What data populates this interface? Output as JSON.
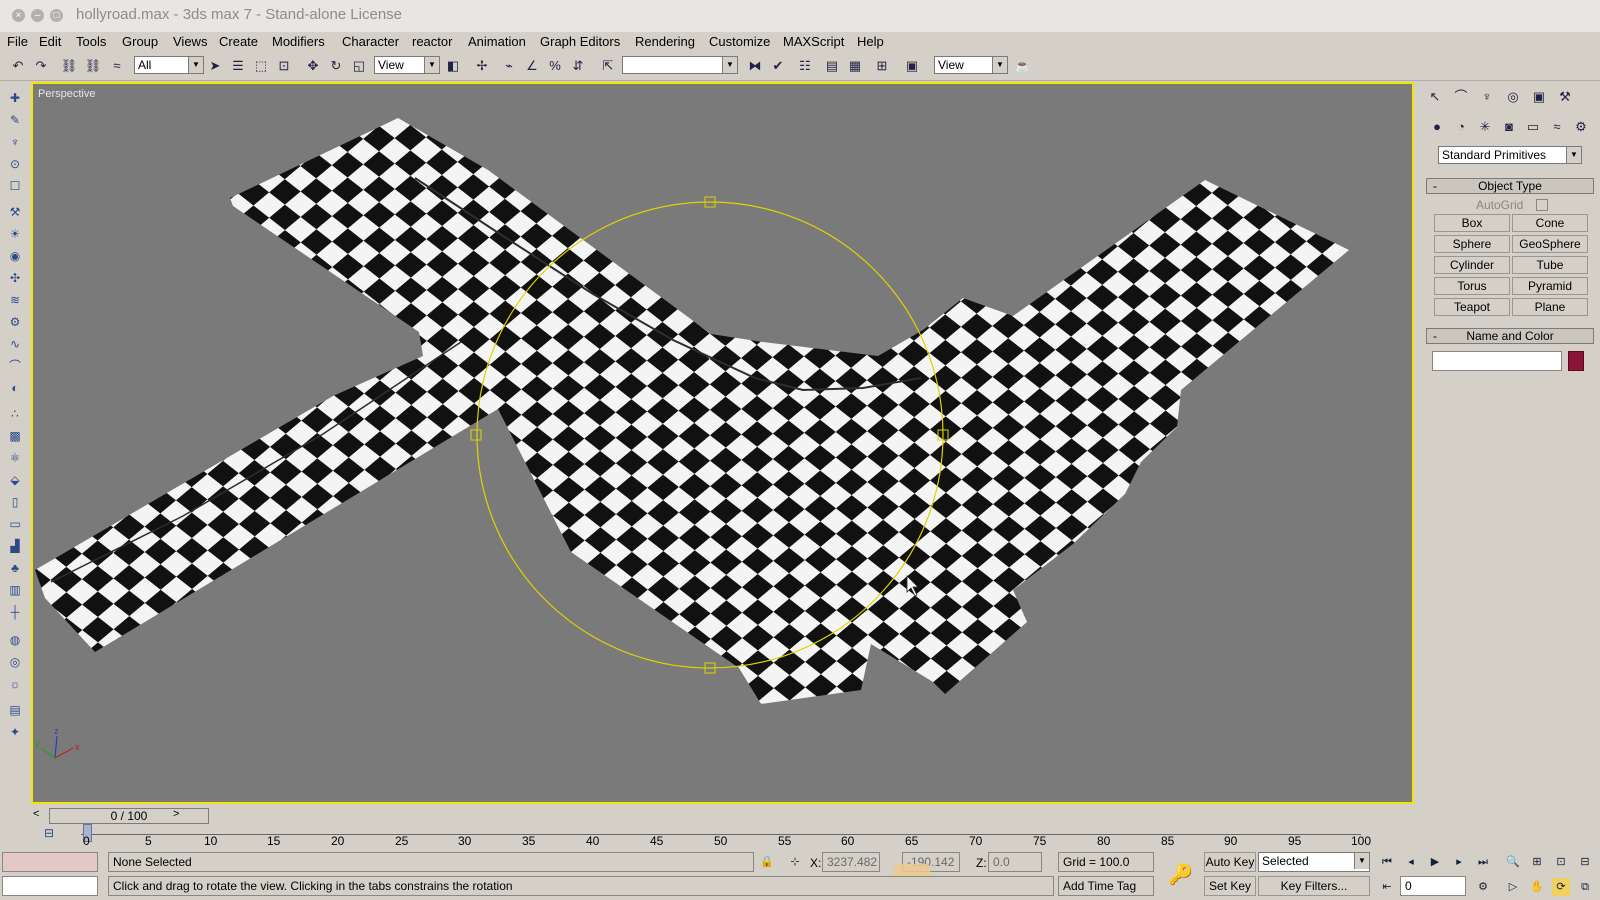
{
  "window": {
    "title": "hollyroad.max - 3ds max 7  - Stand-alone License",
    "close_glyph": "×",
    "minimize_glyph": "–",
    "maximize_glyph": "□"
  },
  "menu": [
    "File",
    "Edit",
    "Tools",
    "Group",
    "Views",
    "Create",
    "Modifiers",
    "Character",
    "reactor",
    "Animation",
    "Graph Editors",
    "Rendering",
    "Customize",
    "MAXScript",
    "Help"
  ],
  "toolbar": {
    "selection_filter": "All",
    "ref_coord": "View",
    "named_selection": "",
    "render_type": "View"
  },
  "viewport": {
    "label": "Perspective"
  },
  "command_panel": {
    "category": "Standard Primitives",
    "object_type_title": "Object Type",
    "autogrid_label": "AutoGrid",
    "primitives": [
      "Box",
      "Cone",
      "Sphere",
      "GeoSphere",
      "Cylinder",
      "Tube",
      "Torus",
      "Pyramid",
      "Teapot",
      "Plane"
    ],
    "name_color_title": "Name and Color",
    "object_name": "",
    "object_color": "#8a1538",
    "rollout_collapse": "-"
  },
  "timeline": {
    "frame_display": "0 / 100",
    "ticks": [
      "0",
      "5",
      "10",
      "15",
      "20",
      "25",
      "30",
      "35",
      "40",
      "45",
      "50",
      "55",
      "60",
      "65",
      "70",
      "75",
      "80",
      "85",
      "90",
      "95",
      "100"
    ]
  },
  "status": {
    "selection_text": "None Selected",
    "prompt": "Click and drag to rotate the view.  Clicking in the tabs constrains the rotation",
    "x_label": "X:",
    "x_value": "3237.482",
    "y_value": "-190.142",
    "z_label": "Z:",
    "z_value": "0.0",
    "grid": "Grid = 100.0",
    "add_time_tag": "Add Time Tag",
    "auto_key": "Auto Key",
    "set_key": "Set Key",
    "key_mode": "Selected",
    "key_filters": "Key Filters...",
    "current_frame": "0"
  },
  "colors": {
    "viewport_bg": "#7a7a7a",
    "active_border": "#f2e600",
    "spline": "#e0d200",
    "ui_bg": "#d4d0c8",
    "checker_dark": "#111111",
    "checker_light": "#f4f4f4"
  }
}
